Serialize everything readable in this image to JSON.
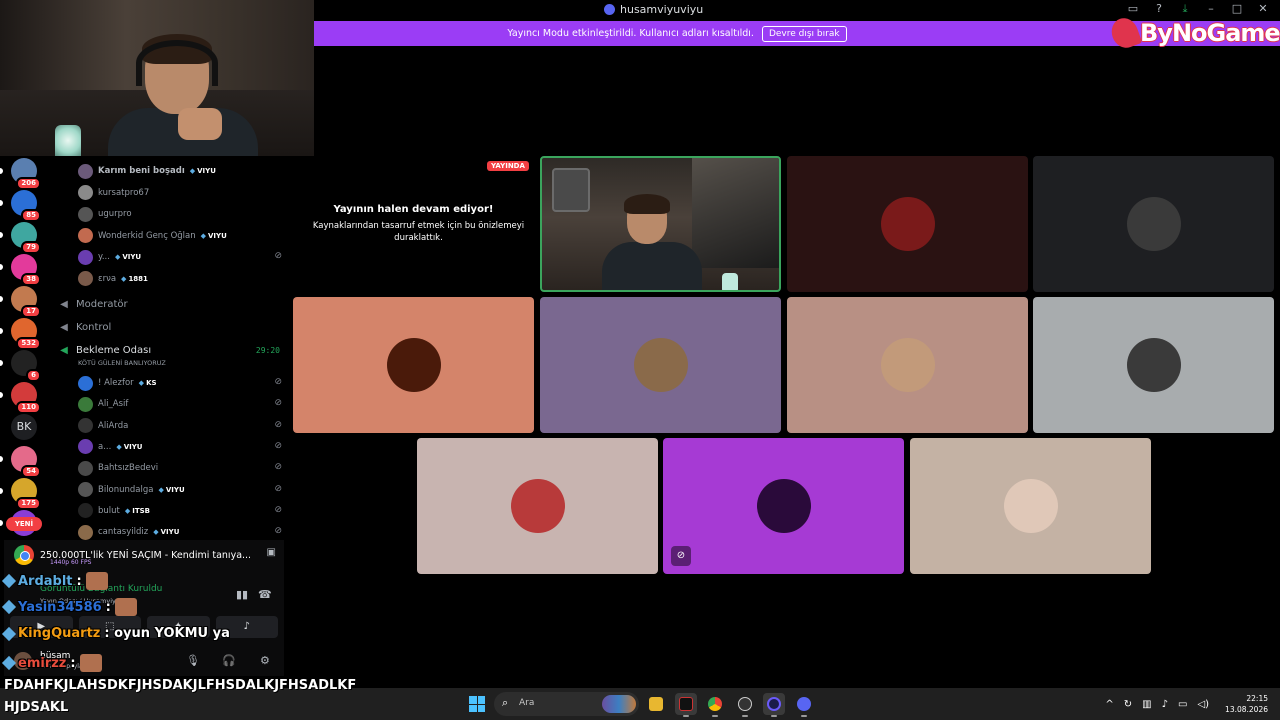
{
  "window": {
    "title": "husamviyuviyu",
    "banner_text": "Yayıncı Modu etkinleştirildi. Kullanıcı adları kısaltıldı.",
    "banner_button": "Devre dışı bırak",
    "overlay_logo": "ByNoGame"
  },
  "servers": [
    {
      "badge": "206",
      "color": "#5a7fb0"
    },
    {
      "badge": "85",
      "color": "#2b6fd6"
    },
    {
      "badge": "79",
      "color": "#3fa7a0"
    },
    {
      "badge": "38",
      "color": "#e33a9b"
    },
    {
      "badge": "17",
      "color": "#c27a4f"
    },
    {
      "badge": "532",
      "color": "#e0662e"
    },
    {
      "badge": "6",
      "color": "#222222"
    },
    {
      "badge": "110",
      "color": "#d33b3b"
    },
    {
      "label": "BK"
    },
    {
      "badge": "54",
      "color": "#e46a8a"
    },
    {
      "badge": "175",
      "color": "#d6a62b"
    },
    {
      "badge": "",
      "color": "#8a3dd6"
    }
  ],
  "new_label": "YENİ",
  "channel_list": {
    "top_members": [
      {
        "name": "Karım beni boşadı",
        "tag": "VIYU",
        "bold": true,
        "color": "#6b5a7a"
      },
      {
        "name": "kursatpro67",
        "tag": "",
        "color": "#8a8a8a"
      },
      {
        "name": "ugurpro",
        "tag": "",
        "color": "#555555"
      },
      {
        "name": "Wonderkid Genç Oğlan",
        "tag": "VIYU",
        "color": "#c26a4f"
      },
      {
        "name": "y...",
        "tag": "VIYU",
        "color": "#6a3db0",
        "muted": true
      },
      {
        "name": "εrνa",
        "tag": "1881",
        "color": "#7a5a4a"
      }
    ],
    "voice_channels": [
      {
        "name": "Moderatör"
      },
      {
        "name": "Kontrol"
      },
      {
        "name": "Bekleme Odası",
        "timer": "29:20",
        "active": true
      }
    ],
    "waiting_subtitle": "KÖTÜ GÜLENİ BANLIYORUZ",
    "waiting_members": [
      {
        "name": "! Alezfor",
        "tag": "KS",
        "color": "#2b6fd6"
      },
      {
        "name": "Ali_Asif",
        "tag": "",
        "color": "#3a7a3a"
      },
      {
        "name": "AliArda",
        "tag": "",
        "color": "#333333"
      },
      {
        "name": "a...",
        "tag": "VIYU",
        "color": "#6a3db0"
      },
      {
        "name": "BahtsızBedevi",
        "tag": "",
        "color": "#4a4a4a"
      },
      {
        "name": "Bilonundalga",
        "tag": "VIYU",
        "color": "#555555"
      },
      {
        "name": "bulut",
        "tag": "ITSB",
        "color": "#222222"
      },
      {
        "name": "cantasyildiz",
        "tag": "VIYU",
        "color": "#8a6a4a"
      }
    ]
  },
  "now_playing": {
    "title": "250.000TL'lik YENİ SAÇIM - Kendimi tanıya...",
    "quality": "1440p 60 FPS"
  },
  "connection": {
    "status": "Görüntülü Bağlantı Kuruldu",
    "channel": "Yayın Odası / Husamviyu"
  },
  "user": {
    "name": "hüsam",
    "status": "Ekranını paylaşıyor"
  },
  "chat": [
    {
      "user": "Ardablt",
      "color": "#5dade2",
      "message": ":"
    },
    {
      "user": "Yasin34586",
      "color": "#2b6fd6",
      "message": ":"
    },
    {
      "user": "KingQuartz",
      "color": "#f39c12",
      "message": ": oyun YOKMU ya"
    },
    {
      "user": "emirzz",
      "color": "#e74c3c",
      "message": ":"
    }
  ],
  "overlay_text_1": "FDAHFKJLAHSDKFJHSDAKJLFHSDALKJFHSADLKF",
  "overlay_text_2": "HJDSAKL",
  "stage": {
    "live_badge": "YAYINDA",
    "paused_title": "Yayının halen devam ediyor!",
    "paused_body": "Kaynaklarından tasarruf etmek için bu önizlemeyi duraklattık.",
    "tiles": [
      {
        "bg": "#2a1212",
        "avatar": "#7a1a1a"
      },
      {
        "bg": "#1e1f22",
        "avatar": "#3a3a3a"
      },
      {
        "bg": "#d4846a",
        "avatar": "#4a1a0a"
      },
      {
        "bg": "#7a6890",
        "avatar": "#8a6a4a"
      },
      {
        "bg": "#b89084",
        "avatar": "#c29a7a"
      },
      {
        "bg": "#a8acae",
        "avatar": "#3a3a3a"
      },
      {
        "bg": "#c8b4b0",
        "avatar": "#b83a3a"
      },
      {
        "bg": "#a63ad4",
        "avatar": "#2a0a3a",
        "muted": true
      },
      {
        "bg": "#c4b2a4",
        "avatar": "#e0c8b8"
      }
    ]
  },
  "taskbar": {
    "search_placeholder": "Ara",
    "time": "22:15",
    "date": "13.08.2026"
  }
}
